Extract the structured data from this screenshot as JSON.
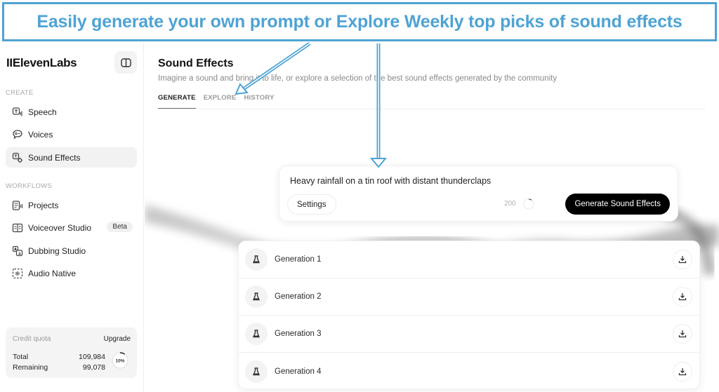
{
  "annotation": {
    "banner_text": "Easily generate your own prompt or Explore Weekly top picks of sound effects",
    "color": "#4ea3d4"
  },
  "sidebar": {
    "logo": "IIElevenLabs",
    "sections": [
      {
        "label": "CREATE",
        "items": [
          {
            "label": "Speech",
            "icon": "speech-icon",
            "active": false
          },
          {
            "label": "Voices",
            "icon": "voices-icon",
            "active": false
          },
          {
            "label": "Sound Effects",
            "icon": "sound-effects-icon",
            "active": true
          }
        ]
      },
      {
        "label": "WORKFLOWS",
        "items": [
          {
            "label": "Projects",
            "icon": "projects-icon"
          },
          {
            "label": "Voiceover Studio",
            "icon": "voiceover-studio-icon",
            "badge": "Beta"
          },
          {
            "label": "Dubbing Studio",
            "icon": "dubbing-studio-icon"
          },
          {
            "label": "Audio Native",
            "icon": "audio-native-icon"
          }
        ]
      }
    ],
    "credit": {
      "title": "Credit quota",
      "upgrade": "Upgrade",
      "total_label": "Total",
      "total_value": "109,984",
      "remaining_label": "Remaining",
      "remaining_value": "99,078",
      "percent_label": "10%",
      "percent_used": 10
    }
  },
  "main": {
    "title": "Sound Effects",
    "subtitle": "Imagine a sound and bring it to life, or explore a selection of the best sound effects generated by the community",
    "tabs": [
      {
        "label": "GENERATE",
        "active": true
      },
      {
        "label": "EXPLORE",
        "active": false
      },
      {
        "label": "HISTORY",
        "active": false
      }
    ],
    "prompt": {
      "text": "Heavy rainfall on a tin roof with distant thunderclaps",
      "settings_label": "Settings",
      "char_count": "200",
      "generate_label": "Generate Sound Effects"
    },
    "generations": [
      {
        "label": "Generation 1"
      },
      {
        "label": "Generation 2"
      },
      {
        "label": "Generation 3"
      },
      {
        "label": "Generation 4"
      }
    ]
  }
}
